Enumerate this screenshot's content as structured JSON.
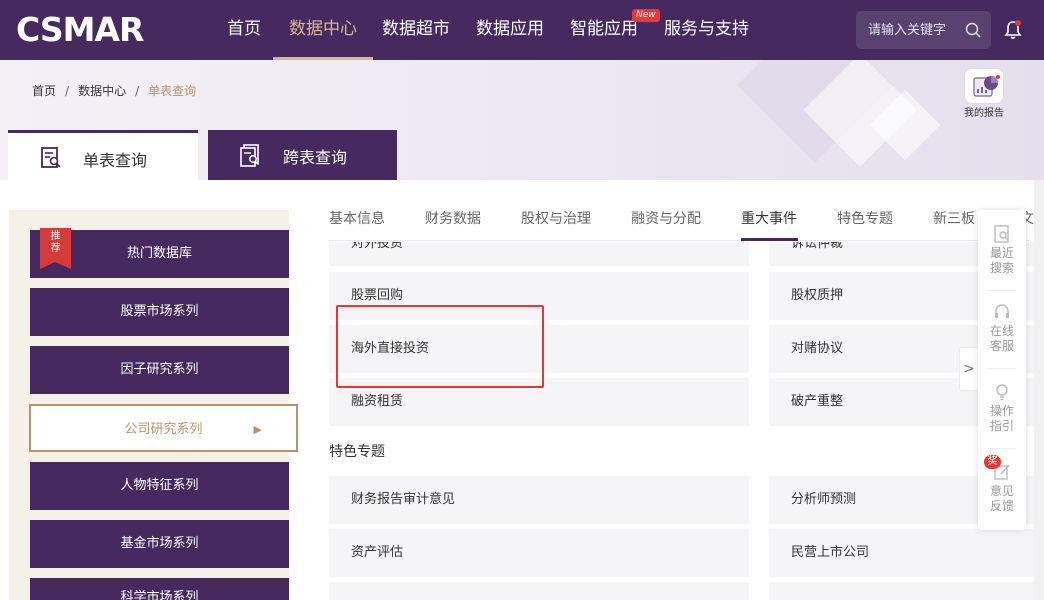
{
  "header": {
    "logo": "CSMAR",
    "nav": [
      "首页",
      "数据中心",
      "数据超市",
      "数据应用",
      "智能应用",
      "服务与支持"
    ],
    "active_nav": "数据中心",
    "new_badge": "New",
    "search_placeholder": "请输入关键字",
    "brand_color": "#46295f",
    "accent_color": "#d8b98e"
  },
  "breadcrumb": [
    "首页",
    "数据中心",
    "单表查询"
  ],
  "report_button": "我的报告",
  "query_tabs": {
    "single": "单表查询",
    "cross": "跨表查询"
  },
  "sidebar": {
    "recommend_badge": "推荐",
    "items": [
      "热门数据库",
      "股票市场系列",
      "因子研究系列",
      "公司研究系列",
      "人物特征系列",
      "基金市场系列",
      "科学市场系列"
    ],
    "active": "公司研究系列"
  },
  "category_tabs": [
    "基本信息",
    "财务数据",
    "股权与治理",
    "融资与分配",
    "重大事件",
    "特色专题",
    "新三板",
    "文本"
  ],
  "active_category": "重大事件",
  "cards": {
    "row0_left": "对外投资",
    "row0_right": "诉讼仲裁",
    "row1_left": "股票回购",
    "row1_right": "股权质押",
    "row2_left": "海外直接投资",
    "row2_right": "对赌协议",
    "row3_left": "融资租赁",
    "row3_right": "破产重整"
  },
  "section_title": "特色专题",
  "special_cards": {
    "row0_left": "财务报告审计意见",
    "row0_right": "分析师预测",
    "row1_left": "资产评估",
    "row1_right": "民营上市公司"
  },
  "float_panel": {
    "recent": [
      "最近",
      "搜索"
    ],
    "online": [
      "在线",
      "客服"
    ],
    "guide": [
      "操作",
      "指引"
    ],
    "feedback": [
      "意见",
      "反馈"
    ],
    "reward_badge": "奖"
  },
  "highlight_color": "#e53935"
}
